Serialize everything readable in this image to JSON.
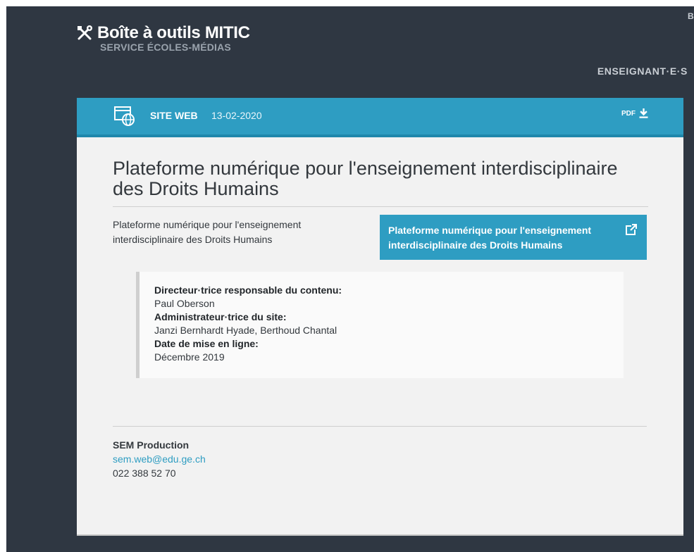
{
  "header": {
    "title": "Boîte à outils MITIC",
    "subtitle": "SERVICE ÉCOLES-MÉDIAS",
    "corner_text": "B",
    "nav_item": "ENSEIGNANT·E·S"
  },
  "card": {
    "type_icon": "web-globe-icon",
    "type_label": "SITE WEB",
    "date": "13-02-2020",
    "pdf_label": "PDF",
    "pdf_icon": "download-icon",
    "title": "Plateforme numérique pour l'enseignement interdisciplinaire des Droits Humains",
    "description": "Plateforme numérique pour l'enseignement interdisciplinaire des Droits Humains",
    "link_label": "Plateforme numérique pour l'enseignement interdisciplinaire des Droits Humains",
    "link_icon": "external-link-icon",
    "info": {
      "director_label": "Directeur·trice responsable du contenu:",
      "director_value": "Paul Oberson",
      "admin_label": "Administrateur·trice du site:",
      "admin_value": "Janzi Bernhardt Hyade, Berthoud Chantal",
      "date_label": "Date de mise en ligne:",
      "date_value": "Décembre 2019"
    }
  },
  "footer": {
    "org": "SEM Production",
    "email": "sem.web@edu.ge.ch",
    "phone": "022 388 52 70"
  },
  "colors": {
    "dark_bg": "#2f3742",
    "accent": "#2e9dc2",
    "card_bg": "#f2f2f2"
  }
}
